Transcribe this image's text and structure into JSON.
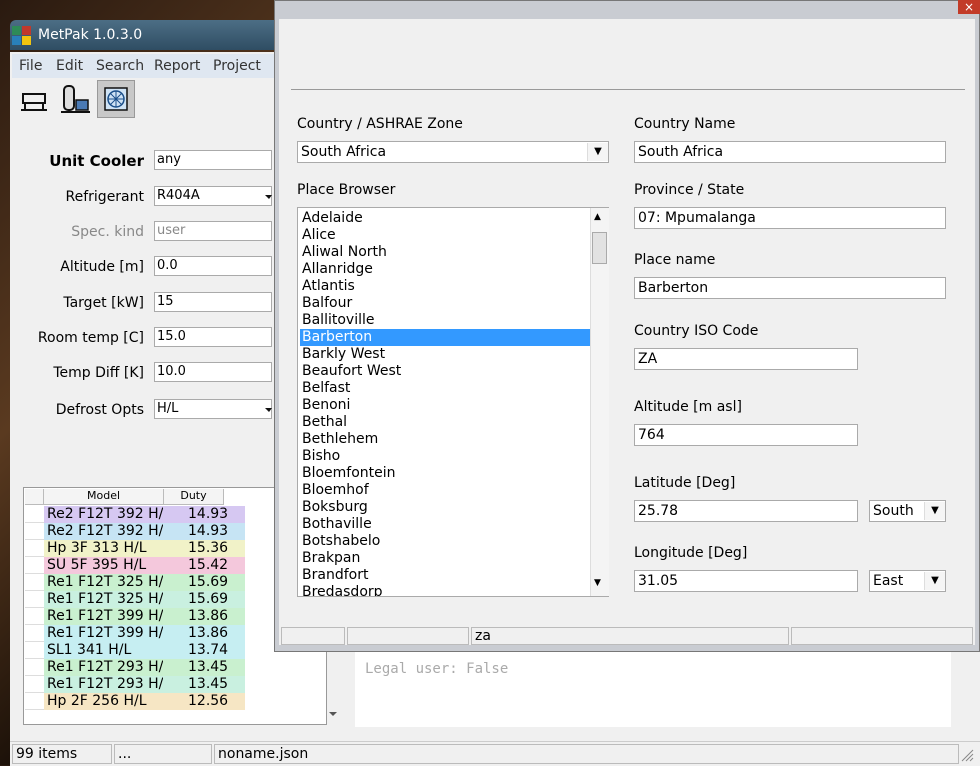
{
  "main_window": {
    "title": "MetPak 1.0.3.0",
    "menu": [
      "File",
      "Edit",
      "Search",
      "Report",
      "Project"
    ],
    "toolbar_icons": [
      "unit-cooler-icon",
      "condensing-unit-icon",
      "fan-coil-icon"
    ],
    "form": {
      "unit_cooler": {
        "label": "Unit Cooler",
        "value": "any"
      },
      "refrigerant": {
        "label": "Refrigerant",
        "value": "R404A"
      },
      "spec_kind": {
        "label": "Spec. kind",
        "value": "user"
      },
      "altitude": {
        "label": "Altitude [m]",
        "value": "0.0"
      },
      "target": {
        "label": "Target [kW]",
        "value": "15"
      },
      "room_temp": {
        "label": "Room temp [C]",
        "value": "15.0"
      },
      "temp_diff": {
        "label": "Temp Diff [K]",
        "value": "10.0"
      },
      "defrost": {
        "label": "Defrost Opts",
        "value": "H/L"
      }
    },
    "grid": {
      "headers": [
        "Model",
        "Duty"
      ],
      "rows": [
        {
          "model": "Re2 F12T 392 H/",
          "duty": "14.93",
          "color": "#d6c8f2"
        },
        {
          "model": "Re2 F12T 392 H/",
          "duty": "14.93",
          "color": "#c6e4f4"
        },
        {
          "model": "Hp 3F 313 H/L",
          "duty": "15.36",
          "color": "#f1f2c8"
        },
        {
          "model": "SU 5F 395 H/L",
          "duty": "15.42",
          "color": "#f4c8dc"
        },
        {
          "model": "Re1 F12T 325 H/",
          "duty": "15.69",
          "color": "#c9f0cf"
        },
        {
          "model": "Re1 F12T 325 H/",
          "duty": "15.69",
          "color": "#c9f0e0"
        },
        {
          "model": "Re1 F12T 399 H/",
          "duty": "13.86",
          "color": "#c9f0cf"
        },
        {
          "model": "Re1 F12T 399 H/",
          "duty": "13.86",
          "color": "#c6eef2"
        },
        {
          "model": "SL1 341 H/L",
          "duty": "13.74",
          "color": "#c6eef2"
        },
        {
          "model": "Re1 F12T 293 H/",
          "duty": "13.45",
          "color": "#c9f0cf"
        },
        {
          "model": "Re1 F12T 293 H/",
          "duty": "13.45",
          "color": "#c9f0e0"
        },
        {
          "model": "Hp 2F 256 H/L",
          "duty": "12.56",
          "color": "#f6e6c4"
        }
      ]
    },
    "console": {
      "line1": "Legal user: False"
    },
    "status": {
      "items": "99 items",
      "middle": "...",
      "file": "noname.json"
    }
  },
  "dialog": {
    "close_glyph": "×",
    "country_zone": {
      "label": "Country / ASHRAE Zone",
      "value": "South Africa"
    },
    "place_browser": {
      "label": "Place Browser",
      "items": [
        "Adelaide",
        "Alice",
        "Aliwal North",
        "Allanridge",
        "Atlantis",
        "Balfour",
        "Ballitoville",
        "Barberton",
        "Barkly West",
        "Beaufort West",
        "Belfast",
        "Benoni",
        "Bethal",
        "Bethlehem",
        "Bisho",
        "Bloemfontein",
        "Bloemhof",
        "Boksburg",
        "Bothaville",
        "Botshabelo",
        "Brakpan",
        "Brandfort",
        "Bredasdorp"
      ],
      "selected": "Barberton"
    },
    "country_name": {
      "label": "Country Name",
      "value": "South Africa"
    },
    "province": {
      "label": "Province / State",
      "value": "07: Mpumalanga"
    },
    "place_name": {
      "label": "Place name",
      "value": "Barberton"
    },
    "iso_code": {
      "label": "Country ISO Code",
      "value": "ZA"
    },
    "altitude": {
      "label": "Altitude [m asl]",
      "value": "764"
    },
    "latitude": {
      "label": "Latitude [Deg]",
      "value": "25.78",
      "hemisphere": "South"
    },
    "longitude": {
      "label": "Longitude [Deg]",
      "value": "31.05",
      "hemisphere": "East"
    },
    "status": {
      "search": "za"
    }
  }
}
